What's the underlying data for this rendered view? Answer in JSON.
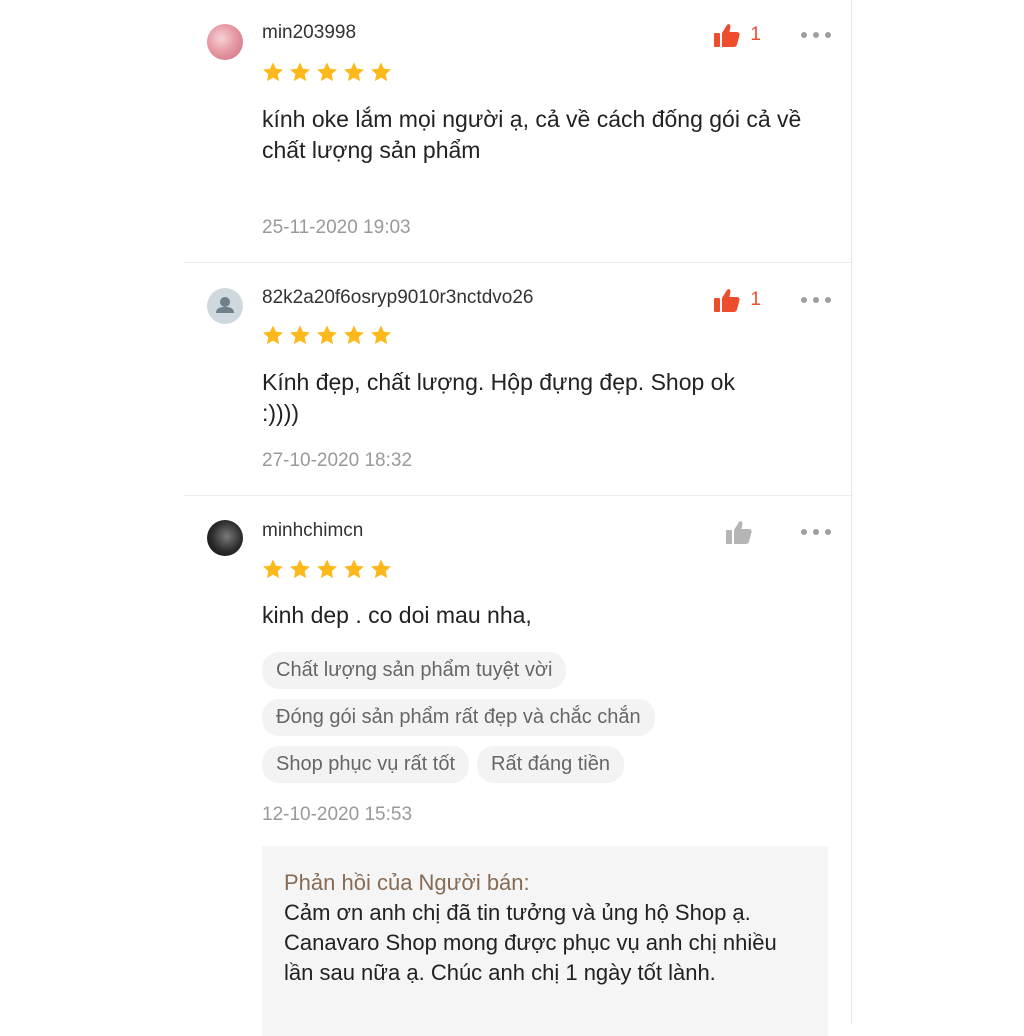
{
  "colors": {
    "accent": "#ee4d2d",
    "star": "#fdb91b",
    "muted": "#999999",
    "seller_label": "#876c55"
  },
  "reviews": [
    {
      "username": "min203998",
      "avatar": "photo-avatar",
      "likes": "1",
      "liked": true,
      "rating": 5,
      "comment": "kính oke lắm mọi người ạ, cả về cách đống gói cả về chất lượng sản phẩm",
      "timestamp": "25-11-2020 19:03"
    },
    {
      "username": "82k2a20f6osryp9010r3nctdvo26",
      "avatar": "default-user-icon",
      "likes": "1",
      "liked": true,
      "rating": 5,
      "comment": "Kính đẹp, chất lượng. Hộp đựng đẹp. Shop ok :))))",
      "timestamp": "27-10-2020 18:32"
    },
    {
      "username": "minhchimcn",
      "avatar": "photo-avatar",
      "likes": "",
      "liked": false,
      "rating": 5,
      "comment": "kinh dep . co doi mau nha,",
      "tags": [
        "Chất lượng sản phẩm tuyệt vời",
        "Đóng gói sản phẩm rất đẹp và chắc chắn",
        "Shop phục vụ rất tốt",
        "Rất đáng tiền"
      ],
      "timestamp": "12-10-2020 15:53",
      "seller_reply": {
        "label": "Phản hồi của Người bán:",
        "text": "Cảm ơn anh chị đã tin tưởng và ủng hộ Shop ạ. Canavaro Shop mong được phục vụ anh chị nhiều lần sau nữa ạ. Chúc anh chị 1 ngày tốt lành."
      }
    }
  ]
}
